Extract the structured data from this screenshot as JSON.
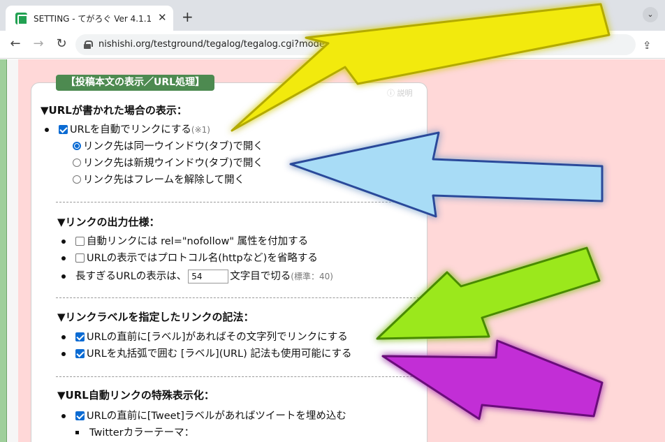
{
  "browser": {
    "tab_title": "SETTING - てがろぐ Ver 4.1.1",
    "tab_close": "✕",
    "new_tab": "+",
    "url": "nishishi.org/testground/tegalog/tegalog.cgi?mode=admin&work=...ting#pPostUrl"
  },
  "panel": {
    "section_title": "【投稿本文の表示／URL処理】",
    "help_label": "ⓘ 説明",
    "heading1": "▼URLが書かれた場合の表示：",
    "autolink_label": "URLを自動でリンクにする",
    "autolink_note": "(※1)",
    "radio_same": "リンク先は同一ウインドウ(タブ)で開く",
    "radio_new": "リンク先は新規ウインドウ(タブ)で開く",
    "radio_frame": "リンク先はフレームを解除して開く",
    "heading2": "▼リンクの出力仕様：",
    "nofollow_label": "自動リンクには rel=\"nofollow\" 属性を付加する",
    "protocol_label": "URLの表示ではプロトコル名(httpなど)を省略する",
    "truncate_prefix": "長すぎるURLの表示は、",
    "truncate_value": "54",
    "truncate_suffix": "文字目で切る",
    "truncate_note": "(標準：40)",
    "heading3": "▼リンクラベルを指定したリンクの記法：",
    "label_prefix_label": "URLの直前に[ラベル]があればその文字列でリンクにする",
    "label_paren_label": "URLを丸括弧で囲む [ラベル](URL) 記法も使用可能にする",
    "heading4": "▼URL自動リンクの特殊表示化：",
    "tweet_label": "URLの直前に[Tweet]ラベルがあればツイートを埋め込む",
    "twitter_theme_label": "Twitterカラーテーマ："
  },
  "colors": {
    "arrow_yellow": "#f2ea0f",
    "arrow_blue": "#a8dcf6",
    "arrow_green": "#9be81c",
    "arrow_purple": "#c22fd6"
  }
}
